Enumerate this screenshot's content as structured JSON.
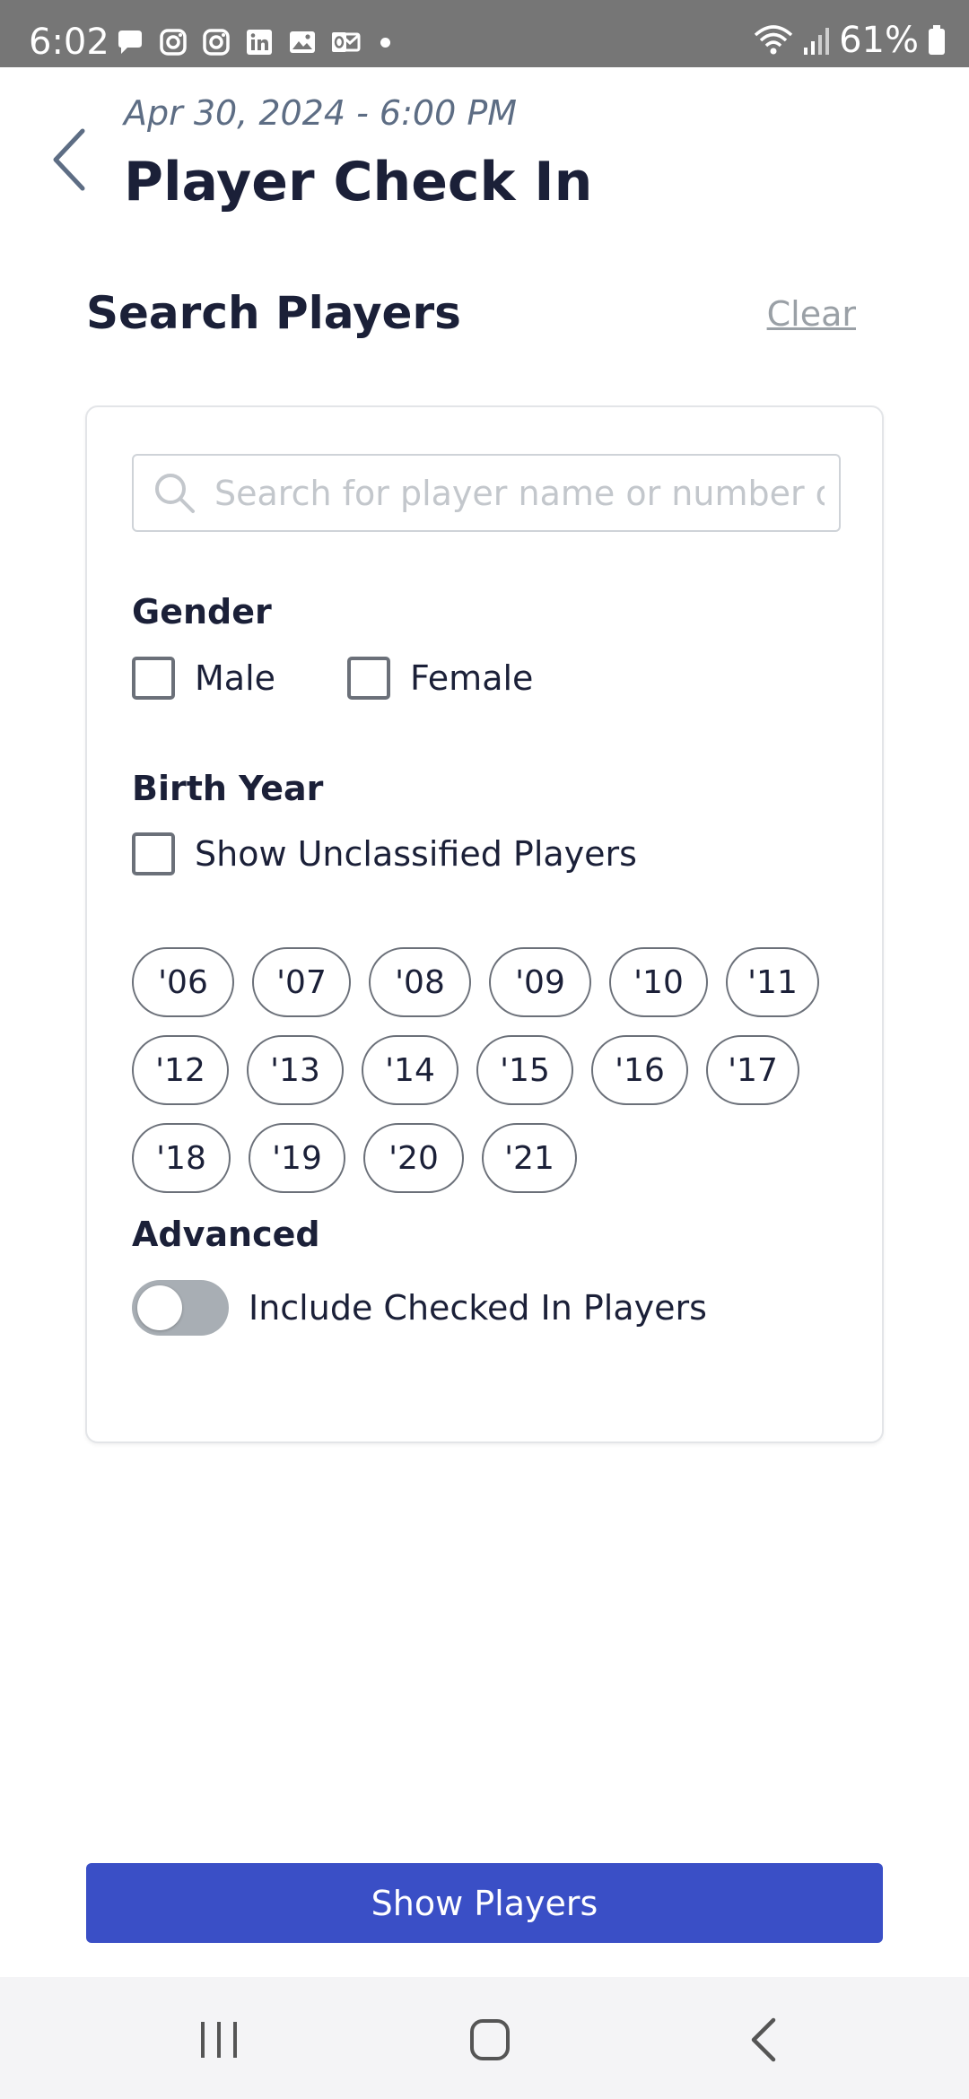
{
  "status_bar": {
    "time": "6:02",
    "battery": "61%",
    "icons": [
      "chat-icon",
      "instagram-icon",
      "instagram-icon",
      "linkedin-icon",
      "gallery-icon",
      "outlook-icon",
      "dot-icon",
      "wifi-icon",
      "signal-icon",
      "battery-icon"
    ]
  },
  "header": {
    "date": "Apr 30, 2024 - 6:00 PM",
    "title": "Player Check In"
  },
  "search_section": {
    "title": "Search Players",
    "clear_label": "Clear",
    "search_placeholder": "Search for player name or number o"
  },
  "gender": {
    "label": "Gender",
    "options": [
      {
        "label": "Male",
        "checked": false
      },
      {
        "label": "Female",
        "checked": false
      }
    ]
  },
  "birth_year": {
    "label": "Birth Year",
    "unclassified_label": "Show Unclassified Players",
    "unclassified_checked": false,
    "years": [
      "'06",
      "'07",
      "'08",
      "'09",
      "'10",
      "'11",
      "'12",
      "'13",
      "'14",
      "'15",
      "'16",
      "'17",
      "'18",
      "'19",
      "'20",
      "'21"
    ]
  },
  "advanced": {
    "label": "Advanced",
    "toggle_label": "Include Checked In Players",
    "toggle_on": false
  },
  "actions": {
    "show_players_label": "Show Players"
  },
  "colors": {
    "status_bar": "#767676",
    "primary": "#3a4fc6",
    "title_text": "#1b2038",
    "date_text": "#5d6d84",
    "toggle_off": "#a8aeb4"
  }
}
